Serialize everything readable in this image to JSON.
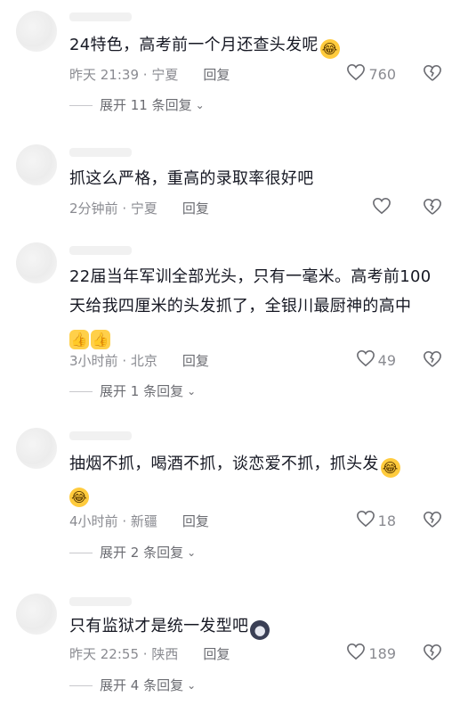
{
  "comments": [
    {
      "text": "24特色，高考前一个月还查头发呢",
      "emojis": [
        "laugh"
      ],
      "time": "昨天 21:39",
      "location": "宁夏",
      "reply_label": "回复",
      "likes": "760",
      "expand": "展开 11 条回复"
    },
    {
      "text": "抓这么严格，重高的录取率很好吧",
      "emojis": [],
      "time": "2分钟前",
      "location": "宁夏",
      "reply_label": "回复",
      "likes": "",
      "expand": ""
    },
    {
      "text_line1": "22届当年军训全部光头，只有一毫米。高考前100",
      "text_line2": "天给我四厘米的头发抓了，全银川最厨神的高中",
      "emojis": [
        "thumb",
        "thumb"
      ],
      "time": "3小时前",
      "location": "北京",
      "reply_label": "回复",
      "likes": "49",
      "expand": "展开 1 条回复"
    },
    {
      "text": "抽烟不抓，喝酒不抓，谈恋爱不抓，抓头发",
      "emojis": [
        "laugh",
        "laugh"
      ],
      "time": "4小时前",
      "location": "新疆",
      "reply_label": "回复",
      "likes": "18",
      "expand": "展开 2 条回复"
    },
    {
      "text": "只有监狱才是统一发型吧",
      "emojis": [
        "dark"
      ],
      "time": "昨天 22:55",
      "location": "陕西",
      "reply_label": "回复",
      "likes": "189",
      "expand": "展开 4 条回复"
    }
  ],
  "separator": " · ",
  "icons": {
    "like": "heart-outline-icon",
    "dislike": "broken-heart-icon",
    "expand": "chevron-down-icon"
  }
}
